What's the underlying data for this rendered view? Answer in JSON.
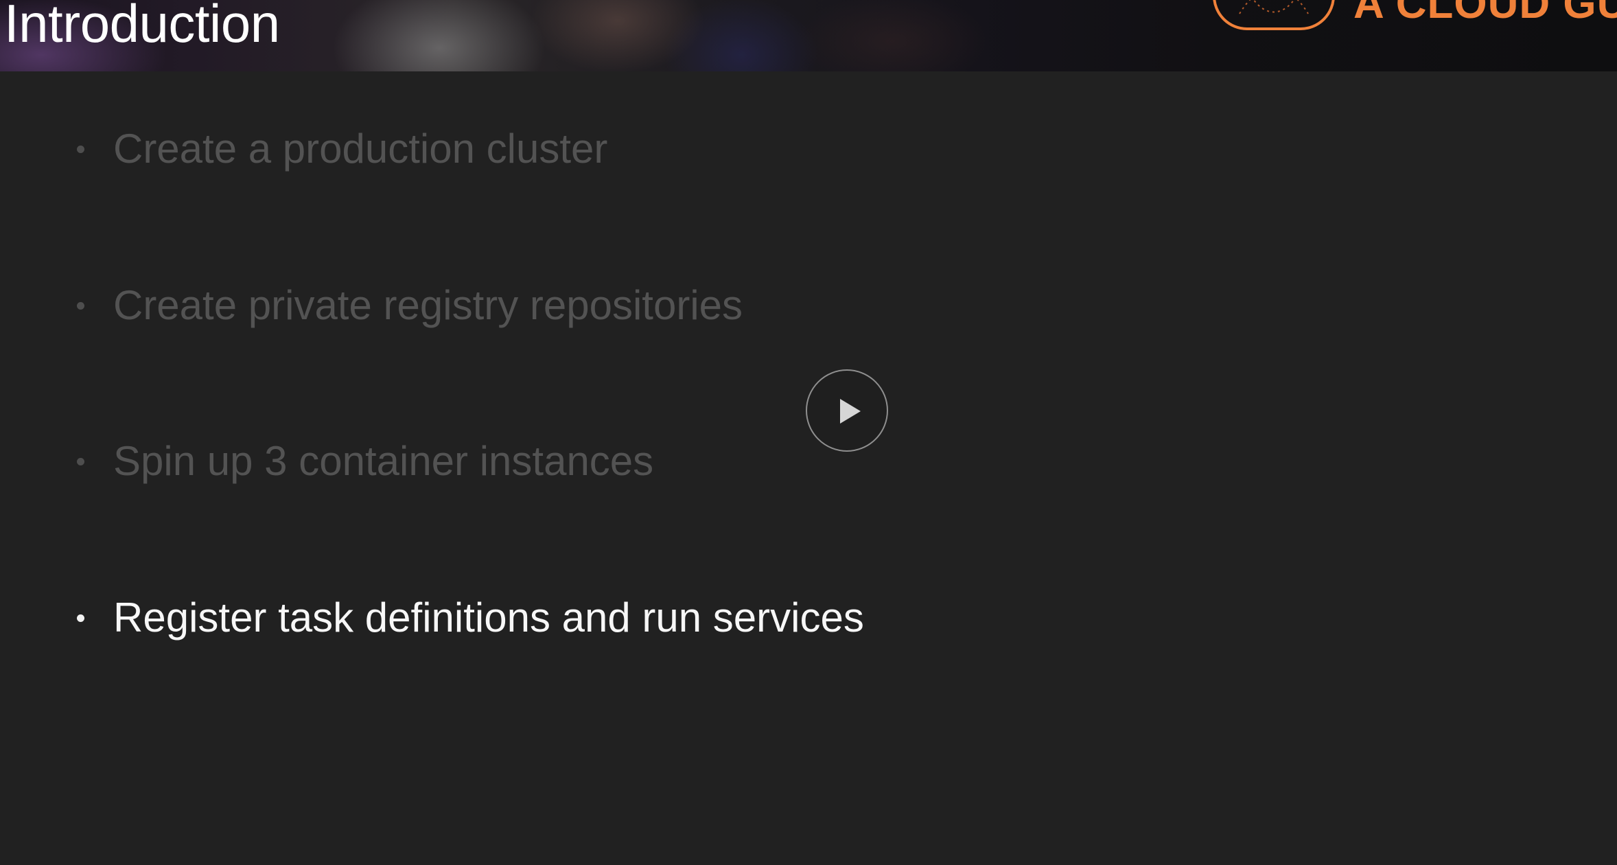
{
  "header": {
    "title": "Introduction",
    "brand_text": "A CLOUD GU"
  },
  "bullets": [
    {
      "text": "Create a production cluster",
      "state": "dimmed"
    },
    {
      "text": "Create private registry repositories",
      "state": "dimmed"
    },
    {
      "text": "Spin up 3 container instances",
      "state": "dimmed"
    },
    {
      "text": "Register task definitions and run services",
      "state": "active"
    }
  ],
  "player": {
    "play_icon": "play-icon"
  },
  "colors": {
    "background": "#212121",
    "brand_orange": "#f0813a",
    "active_text": "#f7f7f7",
    "dimmed_text": "#535353"
  }
}
